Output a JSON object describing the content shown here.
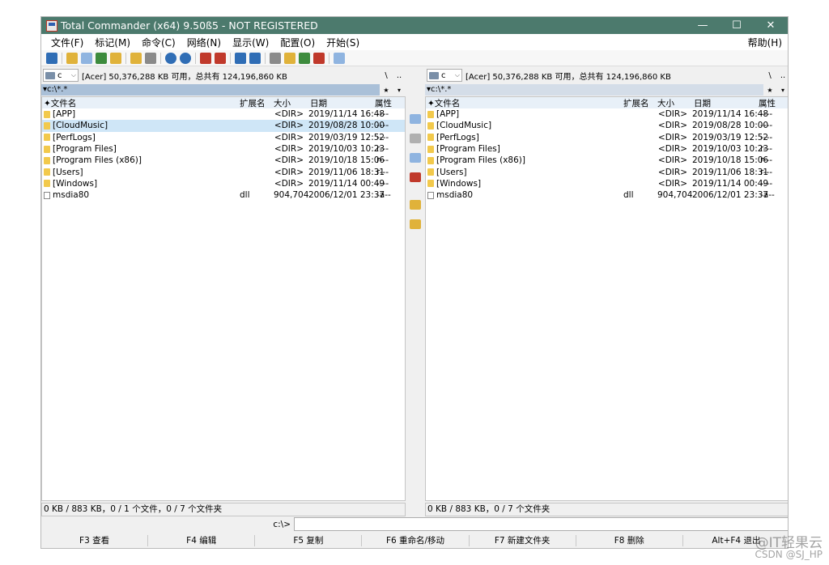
{
  "window": {
    "title": "Total Commander (x64) 9.50ß5 - NOT REGISTERED",
    "min_btn": "—",
    "max_btn": "☐",
    "close_btn": "✕"
  },
  "menu": {
    "items": [
      "文件(F)",
      "标记(M)",
      "命令(C)",
      "网络(N)",
      "显示(W)",
      "配置(O)",
      "开始(S)"
    ],
    "help": "帮助(H)"
  },
  "toolbar": {
    "icons": [
      "refresh-icon",
      "brief-view-icon",
      "full-view-icon",
      "thumbnail-view-icon",
      "tree-view-icon",
      "sort-icon",
      "invert-select-icon",
      "back-icon",
      "forward-icon",
      "pack-icon",
      "unpack-icon",
      "sync-icon",
      "compare-icon",
      "find-icon",
      "multirename-icon",
      "ftp-icon",
      "ftp-new-icon",
      "notepad-icon"
    ],
    "colors": {
      "blue": "#2f6db5",
      "green": "#3d8b3d",
      "yellow": "#e0b23a",
      "red": "#c0392b",
      "gray": "#8a8a8a"
    }
  },
  "left_panel": {
    "drive": "c",
    "drive_info": "[Acer]  50,376,288 KB 可用，总共有 124,196,860 KB",
    "root": "\\",
    "up": "..",
    "path": "▾c:\\*.*",
    "hist": "★",
    "fav": "▾",
    "headers": {
      "name": "✦文件名",
      "ext": "扩展名",
      "size": "大小",
      "date": "日期",
      "attr": "属性"
    },
    "rows": [
      {
        "name": "[APP]",
        "ext": "",
        "size": "<DIR>",
        "date": "2019/11/14 16:48",
        "attr": "----",
        "type": "folder"
      },
      {
        "name": "[CloudMusic]",
        "ext": "",
        "size": "<DIR>",
        "date": "2019/08/28 10:00",
        "attr": "----",
        "type": "folder",
        "selected": true
      },
      {
        "name": "[PerfLogs]",
        "ext": "",
        "size": "<DIR>",
        "date": "2019/03/19 12:52",
        "attr": "----",
        "type": "folder"
      },
      {
        "name": "[Program Files]",
        "ext": "",
        "size": "<DIR>",
        "date": "2019/10/03 10:23",
        "attr": "r---",
        "type": "folder"
      },
      {
        "name": "[Program Files (x86)]",
        "ext": "",
        "size": "<DIR>",
        "date": "2019/10/18 15:06",
        "attr": "r---",
        "type": "folder"
      },
      {
        "name": "[Users]",
        "ext": "",
        "size": "<DIR>",
        "date": "2019/11/06 18:31",
        "attr": "r---",
        "type": "folder"
      },
      {
        "name": "[Windows]",
        "ext": "",
        "size": "<DIR>",
        "date": "2019/11/14 00:49",
        "attr": "----",
        "type": "folder"
      },
      {
        "name": "msdia80",
        "ext": "dll",
        "size": "904,704",
        "date": "2006/12/01 23:37",
        "attr": "-a--",
        "type": "file"
      }
    ],
    "status": "0 KB / 883 KB，0 / 1 个文件，0 / 7 个文件夹"
  },
  "right_panel": {
    "drive": "c",
    "drive_info": "[Acer]  50,376,288 KB 可用，总共有 124,196,860 KB",
    "root": "\\",
    "up": "..",
    "path": "▾c:\\*.*",
    "hist": "★",
    "fav": "▾",
    "headers": {
      "name": "✦文件名",
      "ext": "扩展名",
      "size": "大小",
      "date": "日期",
      "attr": "属性"
    },
    "rows": [
      {
        "name": "[APP]",
        "ext": "",
        "size": "<DIR>",
        "date": "2019/11/14 16:48",
        "attr": "----",
        "type": "folder"
      },
      {
        "name": "[CloudMusic]",
        "ext": "",
        "size": "<DIR>",
        "date": "2019/08/28 10:00",
        "attr": "----",
        "type": "folder"
      },
      {
        "name": "[PerfLogs]",
        "ext": "",
        "size": "<DIR>",
        "date": "2019/03/19 12:52",
        "attr": "----",
        "type": "folder"
      },
      {
        "name": "[Program Files]",
        "ext": "",
        "size": "<DIR>",
        "date": "2019/10/03 10:23",
        "attr": "r---",
        "type": "folder"
      },
      {
        "name": "[Program Files (x86)]",
        "ext": "",
        "size": "<DIR>",
        "date": "2019/10/18 15:06",
        "attr": "r---",
        "type": "folder"
      },
      {
        "name": "[Users]",
        "ext": "",
        "size": "<DIR>",
        "date": "2019/11/06 18:31",
        "attr": "r---",
        "type": "folder"
      },
      {
        "name": "[Windows]",
        "ext": "",
        "size": "<DIR>",
        "date": "2019/11/14 00:49",
        "attr": "----",
        "type": "folder"
      },
      {
        "name": "msdia80",
        "ext": "dll",
        "size": "904,704",
        "date": "2006/12/01 23:37",
        "attr": "-a--",
        "type": "file"
      }
    ],
    "status": "0 KB / 883 KB，0 / 7 个文件夹"
  },
  "middle_icons": [
    "find-files-icon",
    "view-icon",
    "copy-panel-icon",
    "compare-dirs-icon",
    "pack-files-icon",
    "new-folder-icon"
  ],
  "command": {
    "prompt": "c:\\>",
    "value": ""
  },
  "fkeys": [
    "F3 查看",
    "F4 编辑",
    "F5 复制",
    "F6 重命名/移动",
    "F7 新建文件夹",
    "F8 删除",
    "Alt+F4 退出"
  ],
  "watermark": {
    "brand": "@IT轻果云",
    "sub": "CSDN @SJ_HP"
  }
}
